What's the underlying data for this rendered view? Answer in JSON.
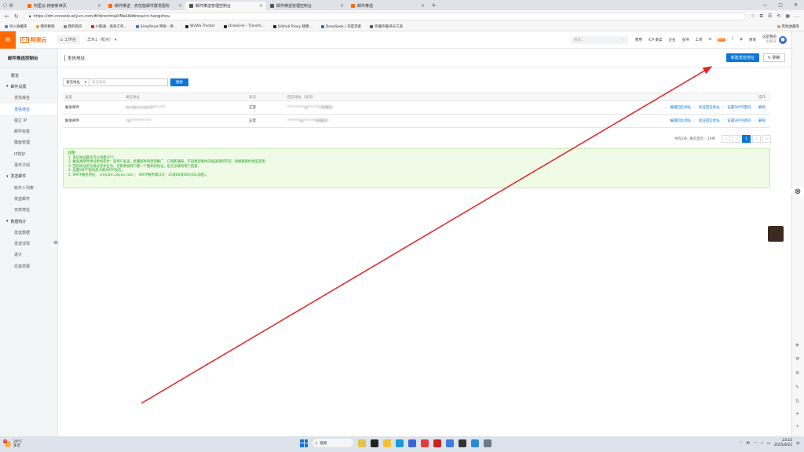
{
  "browser": {
    "tabs": [
      {
        "label": "阿里云-搜索新帝页",
        "icon_color": "#ff6a00",
        "active": false
      },
      {
        "label": "邮件推送 - 高性能邮件群发服务",
        "icon_color": "#ff6a00",
        "active": false
      },
      {
        "label": "邮件推送管理控制台",
        "icon_color": "#555555",
        "active": true
      },
      {
        "label": "邮件推送管理控制台",
        "icon_color": "#555555",
        "active": false
      },
      {
        "label": "邮件推送",
        "icon_color": "#ff6a00",
        "active": false
      }
    ],
    "url": "https://dm.console.aliyun.com/#/directmail/MailAddress/cn-hangzhou",
    "bookmarks": [
      {
        "label": "导入收藏夹",
        "color": "#4a86e8"
      },
      {
        "label": "我的教程",
        "color": "#e6a23c"
      },
      {
        "label": "我的购买",
        "color": "#888888"
      },
      {
        "label": "小鹅通 - 高效工作...",
        "color": "#e02020"
      },
      {
        "label": "SimpRead 简悦 - 将...",
        "color": "#3a7bd5"
      },
      {
        "label": "WuWa Tracker",
        "color": "#222222"
      },
      {
        "label": "DrawLink - Transfo...",
        "color": "#222222"
      },
      {
        "label": "GitHub Proxy 镜像...",
        "color": "#222222"
      },
      {
        "label": "DeepSeek | 深度求索",
        "color": "#3a64d8"
      },
      {
        "label": "鸣潮声骸评分工具",
        "color": "#555555"
      }
    ],
    "other_bookmarks": "其他收藏夹"
  },
  "topnav": {
    "logo_text": "阿里云",
    "workbench": "工作台",
    "region": "华东1（杭州）",
    "search_placeholder": "搜索...",
    "links": [
      "费用",
      "ICP 备案",
      "企业",
      "支持",
      "工单"
    ],
    "badge": "99+",
    "lang": "简体",
    "user_name": "这是我的",
    "user_sub": "主账号"
  },
  "sidebar": {
    "title": "邮件推送控制台",
    "overview": "概览",
    "groups": [
      {
        "label": "邮件设置",
        "items": [
          "发信域名",
          "发信地址",
          "独立 IP",
          "邮件标签",
          "模板管理",
          "IP防护",
          "事件订阅"
        ]
      },
      {
        "label": "发送邮件",
        "items": [
          "收件人列表",
          "发送邮件",
          "无效地址"
        ]
      },
      {
        "label": "数据统计",
        "items": [
          "发送数据",
          "发送详情",
          "退订",
          "垃圾举报"
        ]
      }
    ],
    "active_item": "发信地址"
  },
  "main": {
    "page_title": "发信地址",
    "new_button": "新建发信地址",
    "refresh_button": "刷新",
    "filter_select": "发信地址",
    "filter_placeholder": "发信地址",
    "filter_button": "搜索",
    "table": {
      "headers": [
        "类型",
        "发信地址",
        "状态",
        "回信地址（状态）",
        "操作"
      ],
      "rows": [
        {
          "type": "触发邮件",
          "address": "wordpress@adii***.***",
          "status": "正常",
          "reply": "****.*****@***.***(未通过)"
        },
        {
          "type": "触发邮件",
          "address": "*@********.***",
          "status": "正常",
          "reply": "*******@***.***(未通过)"
        }
      ],
      "actions": [
        "编辑回信地址",
        "验证回信地址",
        "设置SMTP密码",
        "删除"
      ]
    },
    "pagination": {
      "info": "共有2条, 每页显示：10条",
      "current": "1"
    },
    "notice": {
      "title": "提醒:",
      "lines": [
        "1. 发信地址最多可以创建10个。",
        "2. 触发类邮件地址更加适合：逐用户发送，批量邮件和营销推广、订阅和通知，不同类型邮件的发送限制不同，请根据邮件类型选择。",
        "3. 回信地址验证通过后才生效。否则系统将只看一个随机的地址，您无法收到用户回复。",
        "4. 设置SMTP密码后才能SMTP发信。",
        "5. SMTP服务地址： smtpdm.aliyun.com ； SMTP服务端口号：25或80或465(SSL加密)。"
      ]
    }
  },
  "taskbar": {
    "weather_temp": "29°C",
    "weather_desc": "多云",
    "search": "搜索",
    "time": "23:15",
    "date": "2025/8/22",
    "lang": "中"
  },
  "colors": {
    "accent": "#0b77d7",
    "brand": "#ff6a00",
    "notice_bg": "#effbe6",
    "notice_text": "#1e9e1e",
    "annotation_arrow": "#e32222"
  }
}
